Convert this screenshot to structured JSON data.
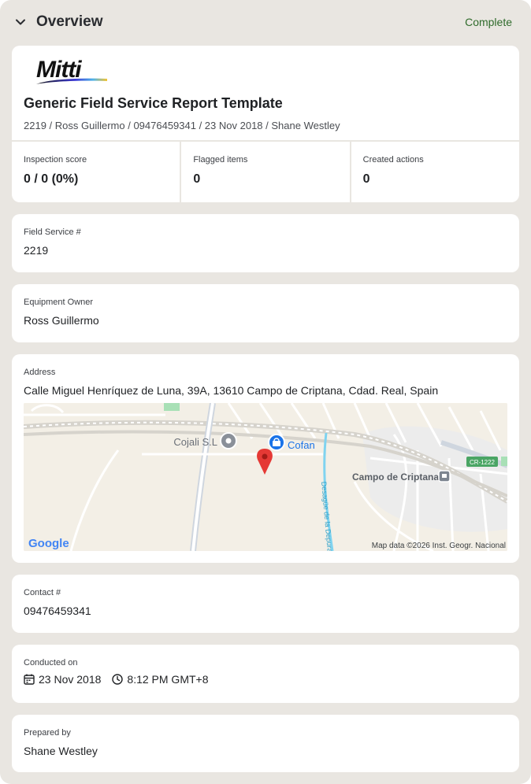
{
  "section": {
    "title": "Overview",
    "status": "Complete"
  },
  "report": {
    "logo_text": "Mitti",
    "title": "Generic Field Service Report Template",
    "subtitle": "2219 / Ross Guillermo / 09476459341 / 23 Nov 2018 / Shane Westley"
  },
  "stats": [
    {
      "label": "Inspection score",
      "value": "0 / 0 (0%)"
    },
    {
      "label": "Flagged items",
      "value": "0"
    },
    {
      "label": "Created actions",
      "value": "0"
    }
  ],
  "fields": {
    "field_service": {
      "label": "Field Service #",
      "value": "2219"
    },
    "equipment_owner": {
      "label": "Equipment Owner",
      "value": "Ross Guillermo"
    },
    "address": {
      "label": "Address",
      "value": "Calle Miguel Henríquez de Luna, 39A, 13610 Campo de Criptana, Cdad. Real, Spain"
    },
    "contact": {
      "label": "Contact #",
      "value": "09476459341"
    },
    "conducted_on": {
      "label": "Conducted on",
      "date": "23 Nov 2018",
      "time": "8:12 PM GMT+8"
    },
    "prepared_by": {
      "label": "Prepared by",
      "value": "Shane Westley"
    }
  },
  "map": {
    "place_1": "Cojali S.L",
    "place_2": "Cofan",
    "place_3": "Campo de Criptana",
    "road_label": "CR-1222",
    "canal_label": "Desagüe de la Depuradora",
    "provider": "Google",
    "attribution": "Map data ©2026 Inst. Geogr. Nacional"
  },
  "colors": {
    "panel_bg": "#e9e6e1",
    "status_green": "#2f6b2b",
    "pin_red": "#e53935",
    "poi_blue": "#1a73e8"
  }
}
